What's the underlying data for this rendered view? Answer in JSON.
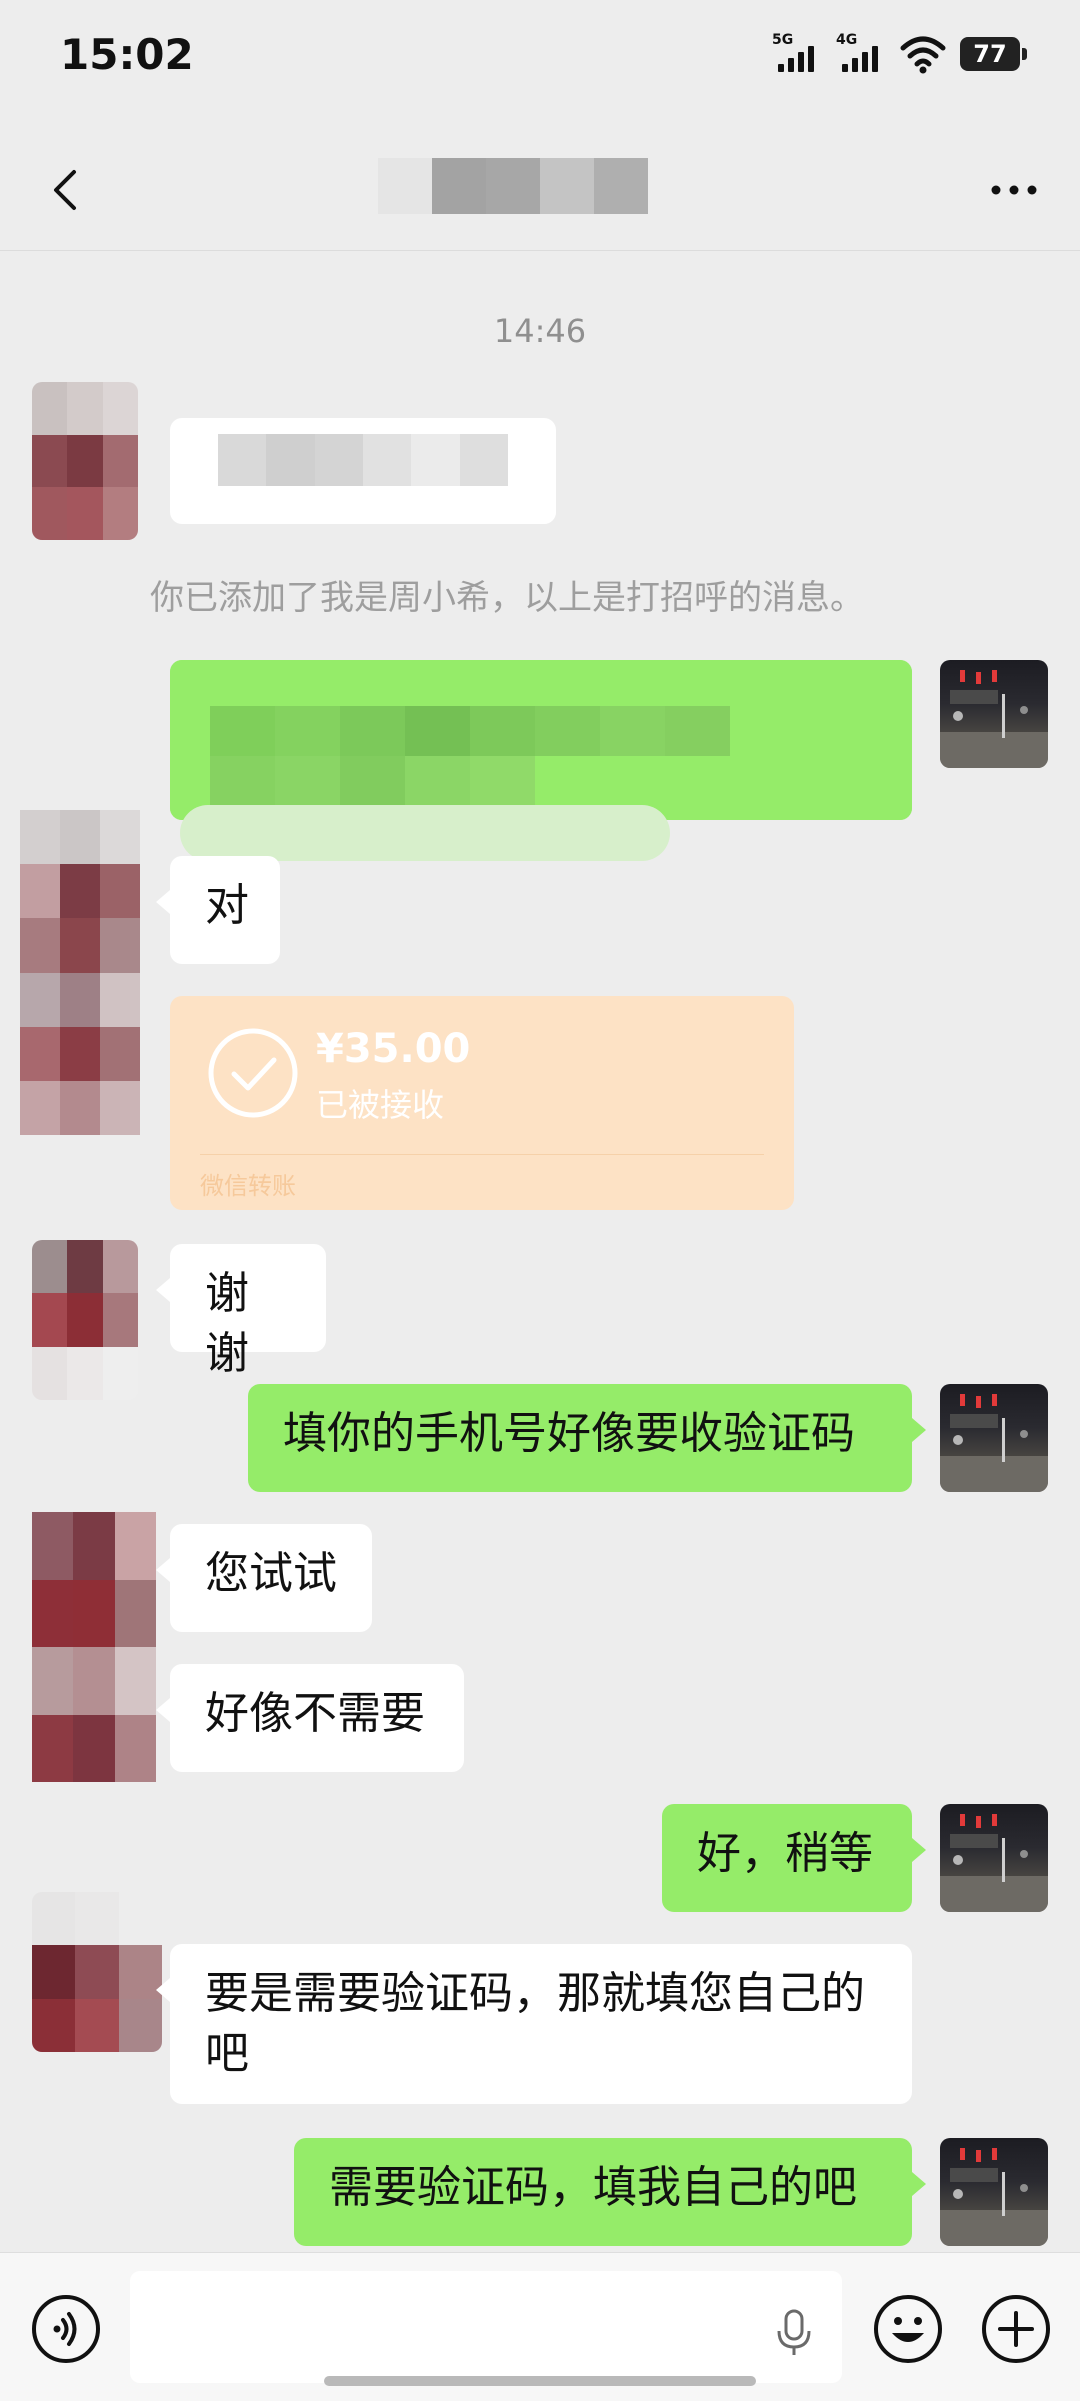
{
  "status_bar": {
    "time": "15:02",
    "signal_1": "5G",
    "signal_2": "4G",
    "battery": "77"
  },
  "header": {
    "title": "",
    "back_icon": "chevron-left-icon",
    "more_icon": "more-dots-icon"
  },
  "chat": {
    "timestamp": "14:46",
    "system_notice": "你已添加了我是周小希，以上是打招呼的消息。",
    "messages": [
      {
        "from": "contact",
        "text": ""
      },
      {
        "from": "self",
        "text": ""
      },
      {
        "from": "contact",
        "text": "对"
      },
      {
        "from": "contact",
        "type": "transfer",
        "amount": "¥35.00",
        "status": "已被接收",
        "brand": "微信转账"
      },
      {
        "from": "contact",
        "text": "谢谢"
      },
      {
        "from": "self",
        "text": "填你的手机号好像要收验证码"
      },
      {
        "from": "contact",
        "text": "您试试"
      },
      {
        "from": "contact",
        "text": "好像不需要"
      },
      {
        "from": "self",
        "text": "好，稍等"
      },
      {
        "from": "contact",
        "text": "要是需要验证码，那就填您自己的吧"
      },
      {
        "from": "self",
        "text": "需要验证码，填我自己的吧"
      }
    ]
  },
  "input_bar": {
    "value": "",
    "placeholder": "",
    "voice_icon": "voice-mode-icon",
    "mic_icon": "microphone-icon",
    "emoji_icon": "emoji-icon",
    "plus_icon": "plus-icon"
  },
  "colors": {
    "background": "#ededed",
    "outgoing_bubble": "#95ec69",
    "incoming_bubble": "#ffffff",
    "transfer_card": "#fde2c5"
  }
}
